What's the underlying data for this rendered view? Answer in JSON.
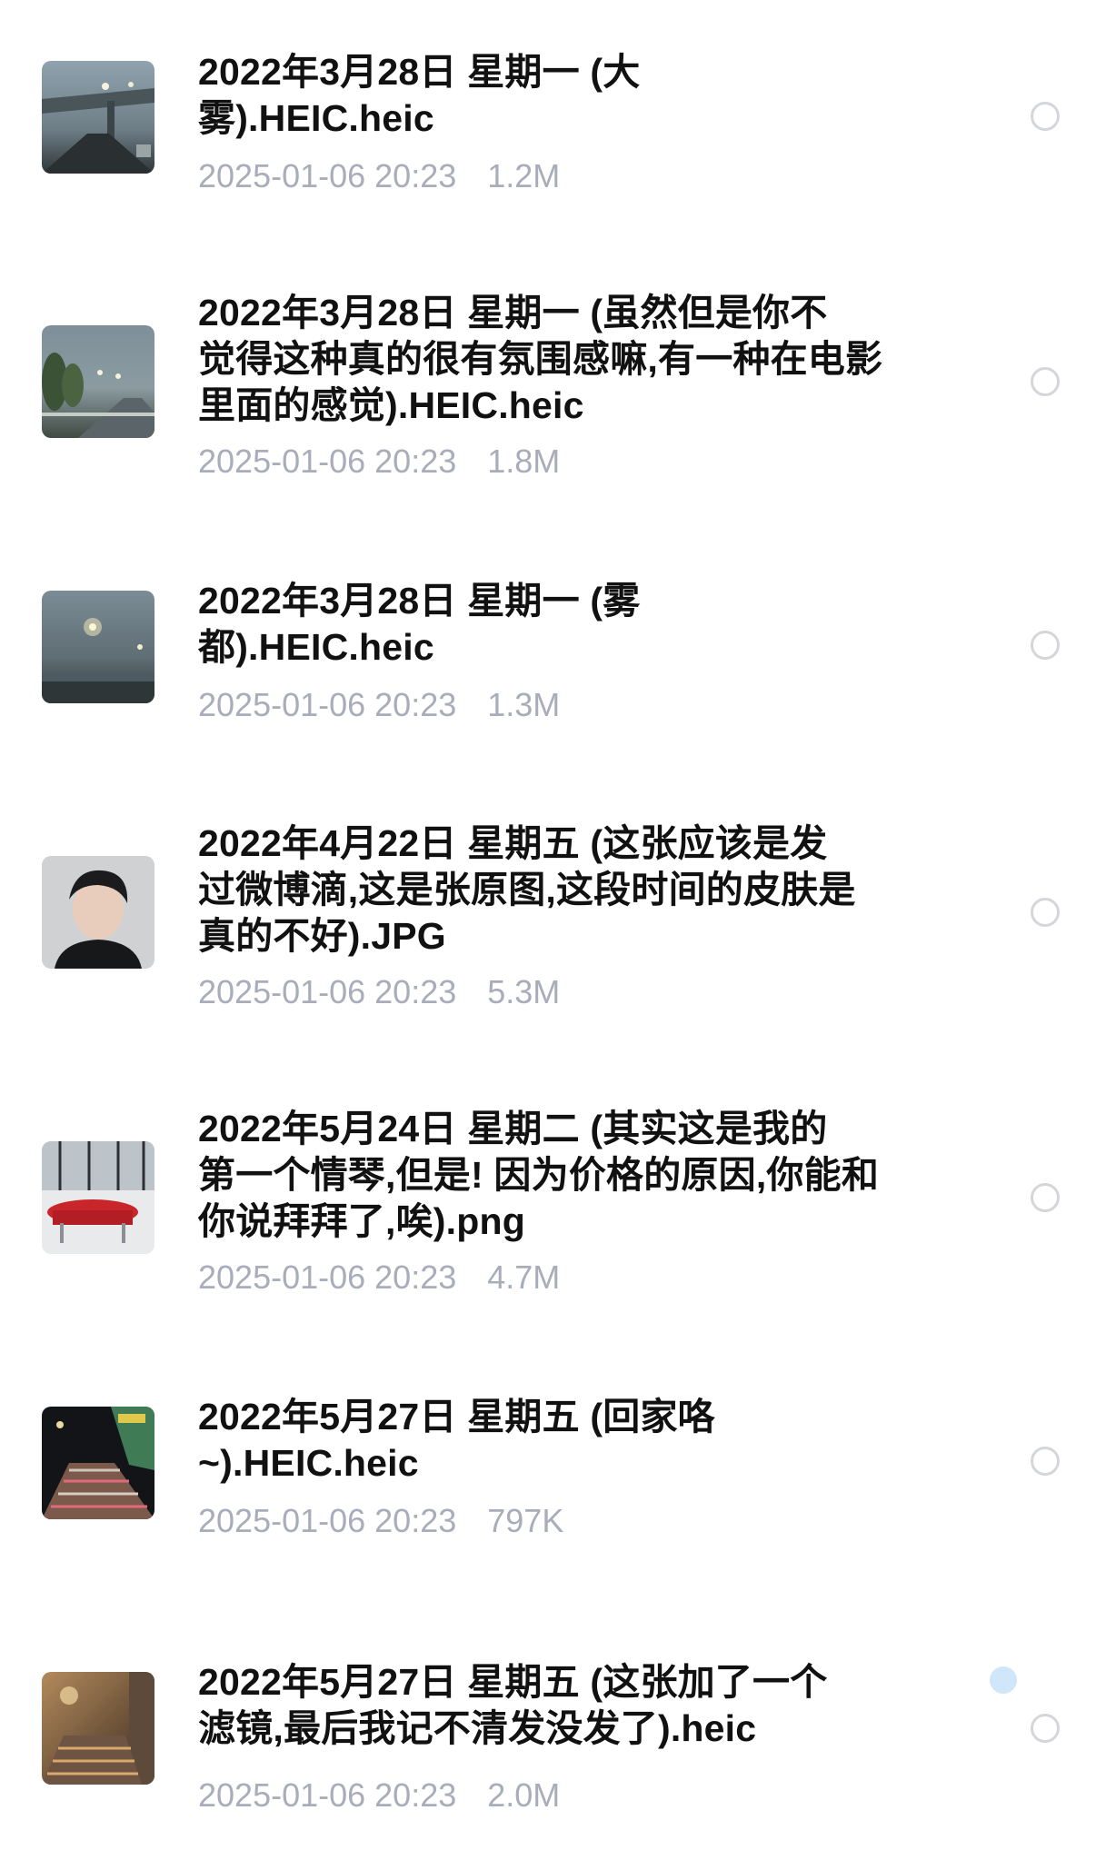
{
  "files": [
    {
      "name": "2022年3月28日 星期一 (大\n雾).HEIC.heic",
      "date": "2025-01-06 20:23",
      "size": "1.2M",
      "thumb_icon": "foggy-bridge-photo-thumbnail"
    },
    {
      "name": "2022年3月28日 星期一 (虽然但是你不\n觉得这种真的很有氛围感嘛,有一种在电影\n里面的感觉).HEIC.heic",
      "date": "2025-01-06 20:23",
      "size": "1.8M",
      "thumb_icon": "foggy-road-trees-photo-thumbnail"
    },
    {
      "name": "2022年3月28日 星期一 (雾\n都).HEIC.heic",
      "date": "2025-01-06 20:23",
      "size": "1.3M",
      "thumb_icon": "foggy-street-lamps-photo-thumbnail"
    },
    {
      "name": "2022年4月22日 星期五 (这张应该是发\n过微博滴,这是张原图,这段时间的皮肤是\n真的不好).JPG",
      "date": "2025-01-06 20:23",
      "size": "5.3M",
      "thumb_icon": "portrait-photo-thumbnail"
    },
    {
      "name": "2022年5月24日 星期二 (其实这是我的\n第一个情琴,但是! 因为价格的原因,你能和\n你说拜拜了,唉).png",
      "date": "2025-01-06 20:23",
      "size": "4.7M",
      "thumb_icon": "red-piano-photo-thumbnail"
    },
    {
      "name": "2022年5月27日 星期五 (回家咯\n~).HEIC.heic",
      "date": "2025-01-06 20:23",
      "size": "797K",
      "thumb_icon": "night-stairs-photo-thumbnail"
    },
    {
      "name": "2022年5月27日 星期五 (这张加了一个\n滤镜,最后我记不清发没发了).heic",
      "date": "2025-01-06 20:23",
      "size": "2.0M",
      "thumb_icon": "warm-stairs-photo-thumbnail"
    }
  ]
}
